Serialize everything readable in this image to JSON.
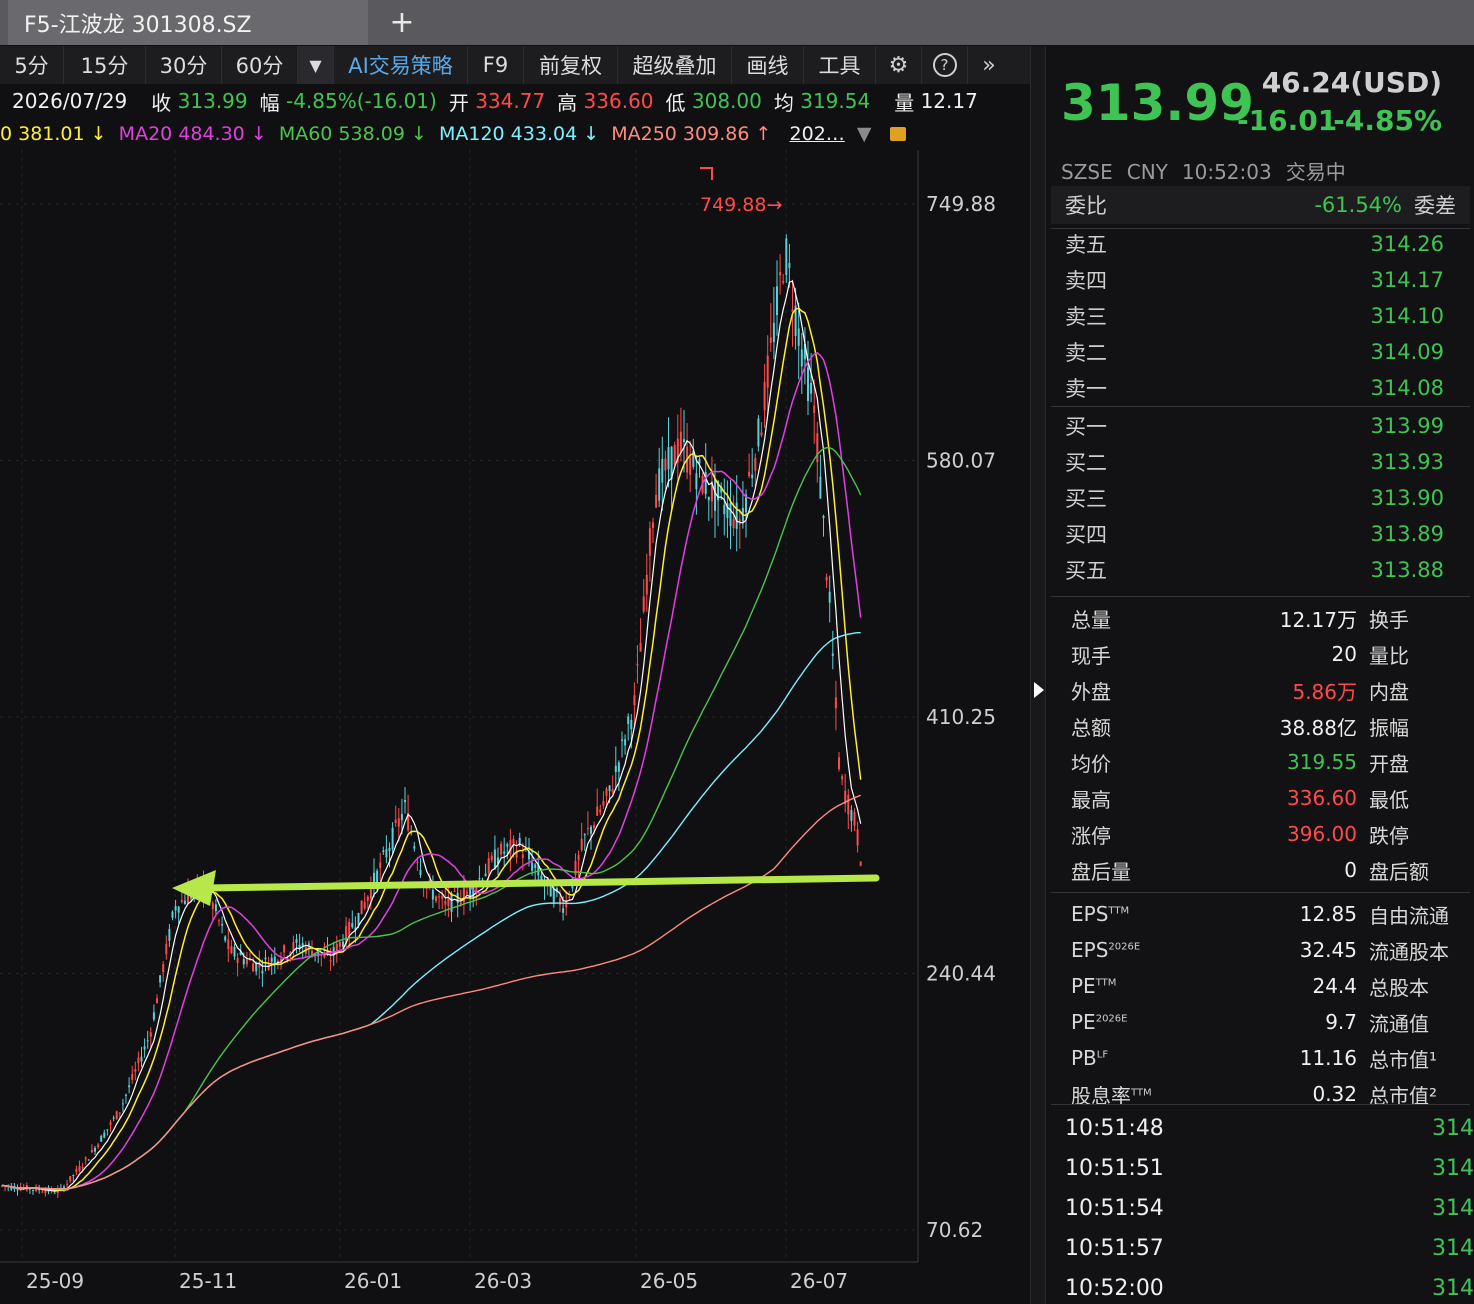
{
  "tab": {
    "title": "F5-江波龙 301308.SZ",
    "add": "+"
  },
  "toolbar": {
    "periods": [
      "5分",
      "15分",
      "30分",
      "60分"
    ],
    "dropdown": "▼",
    "ai": "AI交易策略",
    "items": [
      "F9",
      "前复权",
      "超级叠加",
      "画线",
      "工具"
    ],
    "settings_icon": "⚙",
    "help_icon": "?",
    "more_icon": "»"
  },
  "info": {
    "date": "2026/07/29",
    "close_label": "收",
    "close": "313.99",
    "amp_label": "幅",
    "amp": "-4.85%(-16.01)",
    "open_label": "开",
    "open": "334.77",
    "high_label": "高",
    "high": "336.60",
    "low_label": "低",
    "low": "308.00",
    "avg_label": "均",
    "avg": "319.54",
    "vol_label": "量",
    "vol": "12.17"
  },
  "ma": {
    "ma10": "0 381.01",
    "ma10_arrow": "↓",
    "ma20": "MA20 484.30",
    "ma20_arrow": "↓",
    "ma60": "MA60 538.09",
    "ma60_arrow": "↓",
    "ma120": "MA120 433.04",
    "ma120_arrow": "↓",
    "ma250": "MA250 309.86",
    "ma250_arrow": "↑",
    "more": "202…"
  },
  "chart_data": {
    "type": "candlestick",
    "y_ticks": [
      "749.88",
      "580.07",
      "410.25",
      "240.44",
      "70.62"
    ],
    "x_ticks": [
      "25-09",
      "25-11",
      "26-01",
      "26-03",
      "26-05",
      "26-07"
    ],
    "peak_label": "749.88",
    "ylim": [
      70.62,
      749.88
    ],
    "colors": {
      "up": "#ff4a4a",
      "down": "#5ad0d8",
      "ma5": "#ffffff",
      "ma10": "#ffee33",
      "ma20": "#e040e0",
      "ma60": "#4cc44c",
      "ma120": "#7ef0ff",
      "ma250": "#ff8a80",
      "arrow": "#b6e84a"
    }
  },
  "quote": {
    "price": "313.99",
    "usd": "46.24(USD)",
    "change": "-16.01",
    "change_pct": "-4.85%",
    "exchange": "SZSE",
    "currency": "CNY",
    "time": "10:52:03",
    "state": "交易中"
  },
  "weibi": {
    "label": "委比",
    "value": "-61.54%",
    "label2": "委差"
  },
  "asks": [
    {
      "label": "卖五",
      "price": "314.26"
    },
    {
      "label": "卖四",
      "price": "314.17"
    },
    {
      "label": "卖三",
      "price": "314.10"
    },
    {
      "label": "卖二",
      "price": "314.09"
    },
    {
      "label": "卖一",
      "price": "314.08"
    }
  ],
  "bids": [
    {
      "label": "买一",
      "price": "313.99"
    },
    {
      "label": "买二",
      "price": "313.93"
    },
    {
      "label": "买三",
      "price": "313.90"
    },
    {
      "label": "买四",
      "price": "313.89"
    },
    {
      "label": "买五",
      "price": "313.88"
    }
  ],
  "stats": [
    {
      "k": "总量",
      "v": "12.17万",
      "k2": "换手",
      "c": ""
    },
    {
      "k": "现手",
      "v": "20",
      "k2": "量比",
      "c": ""
    },
    {
      "k": "外盘",
      "v": "5.86万",
      "k2": "内盘",
      "c": "r"
    },
    {
      "k": "总额",
      "v": "38.88亿",
      "k2": "振幅",
      "c": ""
    },
    {
      "k": "均价",
      "v": "319.55",
      "k2": "开盘",
      "c": "g"
    },
    {
      "k": "最高",
      "v": "336.60",
      "k2": "最低",
      "c": "r"
    },
    {
      "k": "涨停",
      "v": "396.00",
      "k2": "跌停",
      "c": "r"
    },
    {
      "k": "盘后量",
      "v": "0",
      "k2": "盘后额",
      "c": ""
    }
  ],
  "fundamentals": [
    {
      "k": "EPS",
      "sup": "TTM",
      "v": "12.85",
      "k2": "自由流通"
    },
    {
      "k": "EPS",
      "sup": "2026E",
      "v": "32.45",
      "k2": "流通股本"
    },
    {
      "k": "PE",
      "sup": "TTM",
      "v": "24.4",
      "k2": "总股本"
    },
    {
      "k": "PE",
      "sup": "2026E",
      "v": "9.7",
      "k2": "流通值"
    },
    {
      "k": "PB",
      "sup": "LF",
      "v": "11.16",
      "k2": "总市值¹"
    },
    {
      "k": "股息率",
      "sup": "TTM",
      "v": "0.32",
      "k2": "总市值²"
    }
  ],
  "ticks": [
    {
      "t": "10:51:48",
      "p": "314"
    },
    {
      "t": "10:51:51",
      "p": "314"
    },
    {
      "t": "10:51:54",
      "p": "314"
    },
    {
      "t": "10:51:57",
      "p": "314"
    },
    {
      "t": "10:52:00",
      "p": "314"
    }
  ]
}
